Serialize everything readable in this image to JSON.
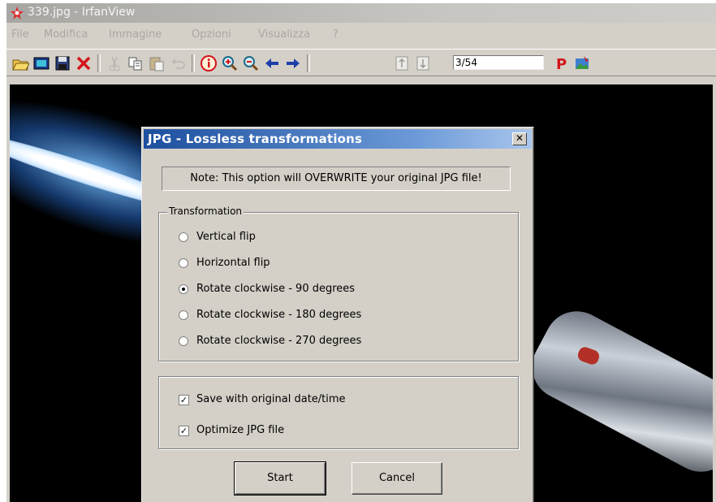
{
  "window": {
    "title": "339.jpg - IrfanView",
    "menu": [
      "File",
      "Modifica",
      "Immagine",
      "Opzioni",
      "Visualizza",
      "?"
    ],
    "toolbar": {
      "page_counter": "3/54",
      "icons": [
        "open-icon",
        "slideshow-icon",
        "save-icon",
        "delete-icon",
        "cut-icon",
        "copy-icon",
        "paste-icon",
        "undo-icon",
        "info-icon",
        "zoom-in-icon",
        "zoom-out-icon",
        "previous-icon",
        "next-icon",
        "first-page-icon",
        "last-page-icon",
        "paypal-icon",
        "irfanview-logo-icon"
      ]
    }
  },
  "dialog": {
    "title": "JPG - Lossless transformations",
    "note": "Note: This option will OVERWRITE your original JPG file!",
    "transformation_group": {
      "label": "Transformation",
      "options": [
        {
          "label": "Vertical flip",
          "selected": false
        },
        {
          "label": "Horizontal flip",
          "selected": false
        },
        {
          "label": "Rotate clockwise - 90 degrees",
          "selected": true
        },
        {
          "label": "Rotate clockwise - 180 degrees",
          "selected": false
        },
        {
          "label": "Rotate clockwise - 270 degrees",
          "selected": false
        }
      ]
    },
    "settings": [
      {
        "label": "Save with original date/time",
        "checked": true
      },
      {
        "label": "Optimize JPG file",
        "checked": true
      }
    ],
    "buttons": {
      "start": "Start",
      "cancel": "Cancel"
    },
    "close_label": "✕"
  },
  "colors": {
    "dialog_title_start": "#1c4f9e",
    "dialog_title_end": "#a9c6ec",
    "face": "#d4d0c8"
  }
}
